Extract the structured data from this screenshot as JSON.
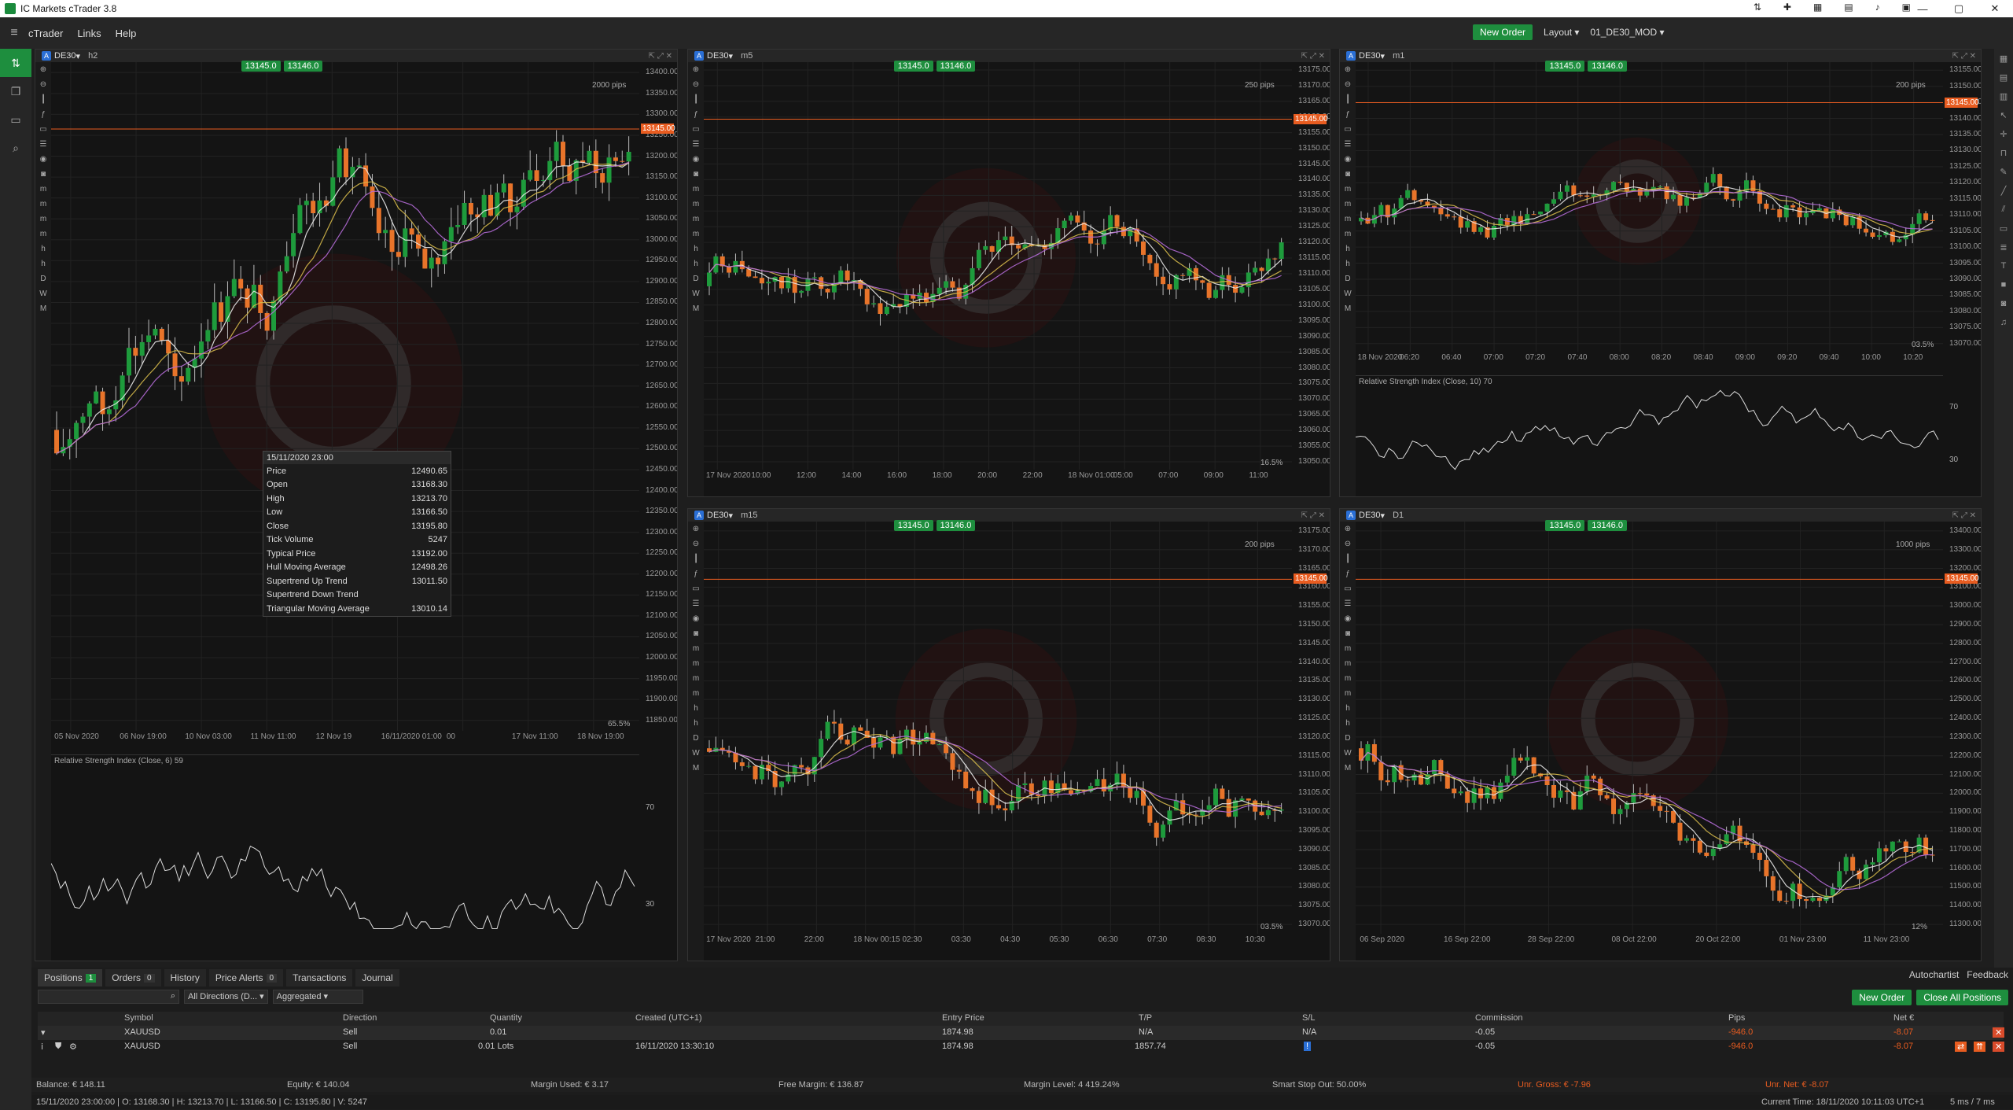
{
  "window": {
    "title": "IC Markets cTrader 3.8",
    "toolbar_icons": [
      "sync-icon",
      "pin-icon",
      "calculator-icon",
      "chat-icon",
      "sound-icon",
      "tile-icon"
    ]
  },
  "menu": {
    "items": [
      "cTrader",
      "Links",
      "Help"
    ],
    "new_order": "New Order",
    "layout": "Layout",
    "workspace": "01_DE30_MOD"
  },
  "colors": {
    "bull": "#1e9b3c",
    "bear": "#e8742a",
    "accent": "#1e8e3e",
    "price_line": "#e85c20"
  },
  "charts": [
    {
      "symbol": "DE30",
      "timeframe": "h2",
      "sell": "13145.0",
      "buy": "13146.0",
      "current": "13145.00",
      "pips": "2000 pips",
      "yticks": [
        "13400.00",
        "13350.00",
        "13300.00",
        "13250.00",
        "13200.00",
        "13150.00",
        "13100.00",
        "13050.00",
        "13000.00",
        "12950.00",
        "12900.00",
        "12850.00",
        "12800.00",
        "12750.00",
        "12700.00",
        "12650.00",
        "12600.00",
        "12550.00",
        "12500.00",
        "12450.00",
        "12400.00",
        "12350.00",
        "12300.00",
        "12250.00",
        "12200.00",
        "12150.00",
        "12100.00",
        "12050.00",
        "12000.00",
        "11950.00",
        "11900.00",
        "11850.00"
      ],
      "xticks": [
        "05 Nov 2020",
        "06 Nov 19:00",
        "10 Nov 03:00",
        "11 Nov 11:00",
        "12 Nov 19",
        "16/11/2020 01:00",
        "00",
        "17 Nov 11:00",
        "18 Nov 19:00"
      ],
      "sub": {
        "label": "Relative Strength Index (Close, 6) 59",
        "levels": [
          "70",
          "30"
        ]
      },
      "zoom": "65.5%"
    },
    {
      "symbol": "DE30",
      "timeframe": "m5",
      "sell": "13145.0",
      "buy": "13146.0",
      "current": "13145.00",
      "pips": "250 pips",
      "yticks": [
        "13175.00",
        "13170.00",
        "13165.00",
        "13160.00",
        "13155.00",
        "13150.00",
        "13145.00",
        "13140.00",
        "13135.00",
        "13130.00",
        "13125.00",
        "13120.00",
        "13115.00",
        "13110.00",
        "13105.00",
        "13100.00",
        "13095.00",
        "13090.00",
        "13085.00",
        "13080.00",
        "13075.00",
        "13070.00",
        "13065.00",
        "13060.00",
        "13055.00",
        "13050.00"
      ],
      "xticks": [
        "17 Nov 2020",
        "10:00",
        "12:00",
        "14:00",
        "16:00",
        "18:00",
        "20:00",
        "22:00",
        "18 Nov 01:00",
        "05:00",
        "07:00",
        "09:00",
        "11:00"
      ],
      "zoom": "16.5%"
    },
    {
      "symbol": "DE30",
      "timeframe": "m1",
      "sell": "13145.0",
      "buy": "13146.0",
      "current": "13145.00",
      "pips": "200 pips",
      "yticks": [
        "13155.00",
        "13150.00",
        "13145.00",
        "13140.00",
        "13135.00",
        "13130.00",
        "13125.00",
        "13120.00",
        "13115.00",
        "13110.00",
        "13105.00",
        "13100.00",
        "13095.00",
        "13090.00",
        "13085.00",
        "13080.00",
        "13075.00",
        "13070.00"
      ],
      "xticks": [
        "18 Nov 2020",
        "06:20",
        "06:40",
        "07:00",
        "07:20",
        "07:40",
        "08:00",
        "08:20",
        "08:40",
        "09:00",
        "09:20",
        "09:40",
        "10:00",
        "10:20"
      ],
      "sub": {
        "label": "Relative Strength Index (Close, 10) 70",
        "levels": [
          "70",
          "30"
        ]
      },
      "zoom": "03.5%"
    },
    {
      "symbol": "DE30",
      "timeframe": "m15",
      "sell": "13145.0",
      "buy": "13146.0",
      "current": "13145.00",
      "pips": "200 pips",
      "yticks": [
        "13175.00",
        "13170.00",
        "13165.00",
        "13160.00",
        "13155.00",
        "13150.00",
        "13145.00",
        "13140.00",
        "13135.00",
        "13130.00",
        "13125.00",
        "13120.00",
        "13115.00",
        "13110.00",
        "13105.00",
        "13100.00",
        "13095.00",
        "13090.00",
        "13085.00",
        "13080.00",
        "13075.00",
        "13070.00"
      ],
      "xticks": [
        "17 Nov 2020",
        "21:00",
        "22:00",
        "18 Nov 00:15",
        "02:30",
        "03:30",
        "04:30",
        "05:30",
        "06:30",
        "07:30",
        "08:30",
        "10:30"
      ],
      "zoom": "03.5%"
    },
    {
      "symbol": "DE30",
      "timeframe": "D1",
      "sell": "13145.0",
      "buy": "13146.0",
      "current": "13145.00",
      "pips": "1000 pips",
      "yticks": [
        "13400.00",
        "13300.00",
        "13200.00",
        "13100.00",
        "13000.00",
        "12900.00",
        "12800.00",
        "12700.00",
        "12600.00",
        "12500.00",
        "12400.00",
        "12300.00",
        "12200.00",
        "12100.00",
        "12000.00",
        "11900.00",
        "11800.00",
        "11700.00",
        "11600.00",
        "11500.00",
        "11400.00",
        "11300.00"
      ],
      "xticks": [
        "06 Sep 2020",
        "16 Sep 22:00",
        "28 Sep 22:00",
        "08 Oct 22:00",
        "20 Oct 22:00",
        "01 Nov 23:00",
        "11 Nov 23:00"
      ],
      "zoom": "12%"
    }
  ],
  "tooltip": {
    "date": "15/11/2020 23:00",
    "rows": [
      {
        "k": "Price",
        "v": "12490.65"
      },
      {
        "k": "Open",
        "v": "13168.30"
      },
      {
        "k": "High",
        "v": "13213.70"
      },
      {
        "k": "Low",
        "v": "13166.50"
      },
      {
        "k": "Close",
        "v": "13195.80"
      },
      {
        "k": "Tick Volume",
        "v": "5247"
      },
      {
        "k": "Typical Price",
        "v": "13192.00"
      },
      {
        "k": "Hull Moving Average",
        "v": "12498.26"
      },
      {
        "k": "Supertrend Up Trend",
        "v": "13011.50"
      },
      {
        "k": "Supertrend Down Trend",
        "v": ""
      },
      {
        "k": "Triangular Moving Average",
        "v": "13010.14"
      }
    ]
  },
  "panel": {
    "tabs": [
      {
        "label": "Positions",
        "count": "1"
      },
      {
        "label": "Orders",
        "count": "0"
      },
      {
        "label": "History",
        "count": ""
      },
      {
        "label": "Price Alerts",
        "count": "0"
      },
      {
        "label": "Transactions",
        "count": ""
      },
      {
        "label": "Journal",
        "count": ""
      }
    ],
    "autochartist": "Autochartist",
    "feedback": "Feedback",
    "filter_direction": "All Directions (D...",
    "filter_mode": "Aggregated",
    "new_order": "New Order",
    "close_all": "Close All Positions",
    "columns": [
      "Symbol",
      "Direction",
      "Quantity",
      "Created (UTC+1)",
      "Entry Price",
      "T/P",
      "S/L",
      "Commission",
      "Pips",
      "Net €"
    ],
    "group_row": {
      "symbol": "XAUUSD",
      "direction": "Sell",
      "quantity": "0.01",
      "created": "",
      "entry": "1874.98",
      "tp": "N/A",
      "sl": "N/A",
      "commission": "-0.05",
      "pips": "-946.0",
      "net": "-8.07"
    },
    "row": {
      "symbol": "XAUUSD",
      "direction": "Sell",
      "quantity": "0.01 Lots",
      "created": "16/11/2020 13:30:10",
      "entry": "1874.98",
      "tp": "1857.74",
      "sl": "",
      "commission": "-0.05",
      "pips": "-946.0",
      "net": "-8.07"
    },
    "account": {
      "balance": "Balance: € 148.11",
      "equity": "Equity: € 140.04",
      "margin_used": "Margin Used: € 3.17",
      "free_margin": "Free Margin: € 136.87",
      "margin_level": "Margin Level: 4 419.24%",
      "smart_stop": "Smart Stop Out: 50.00%",
      "unr_gross": "Unr. Gross: € -7.96",
      "unr_net": "Unr. Net: € -8.07"
    },
    "status_bar": "15/11/2020 23:00:00 | O: 13168.30 | H: 13213.70 | L: 13166.50 | C: 13195.80 | V: 5247",
    "current_time": "Current Time: 18/11/2020 10:11:03  UTC+1",
    "latency": "5 ms / 7 ms"
  }
}
